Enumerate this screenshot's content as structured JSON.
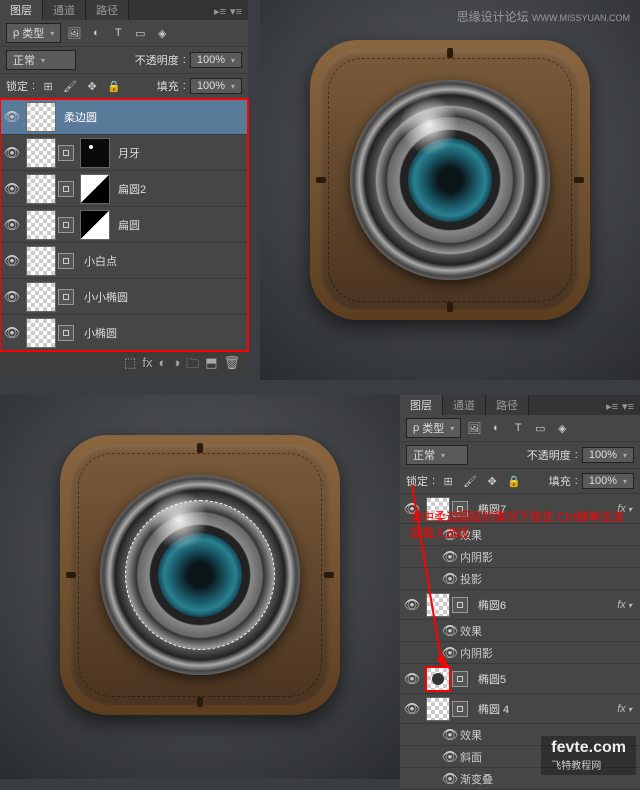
{
  "watermark_main": "思缘设计论坛",
  "watermark_url": "WWW.MISSYUAN.COM",
  "watermark_bottom": "fevte.com",
  "watermark_bottom_cn": "飞特教程网",
  "panel1": {
    "tabs": [
      "图层",
      "通道",
      "路径"
    ],
    "active_tab": 0,
    "kind_label": "类型",
    "blend_mode": "正常",
    "opacity_label": "不透明度",
    "opacity_value": "100%",
    "lock_label": "锁定",
    "fill_label": "填充",
    "fill_value": "100%",
    "layers": [
      {
        "name": "柔边圆",
        "visible": true,
        "selected": true,
        "thumbs": [
          "checker"
        ]
      },
      {
        "name": "月牙",
        "visible": true,
        "selected": false,
        "thumbs": [
          "checker",
          "vec",
          "black"
        ]
      },
      {
        "name": "扁圆2",
        "visible": true,
        "selected": false,
        "thumbs": [
          "checker",
          "vec",
          "diag1"
        ]
      },
      {
        "name": "扁圆",
        "visible": true,
        "selected": false,
        "thumbs": [
          "checker",
          "vec",
          "diag2"
        ]
      },
      {
        "name": "小白点",
        "visible": true,
        "selected": false,
        "thumbs": [
          "checker",
          "vec"
        ]
      },
      {
        "name": "小小椭圆",
        "visible": true,
        "selected": false,
        "thumbs": [
          "checker",
          "vec"
        ]
      },
      {
        "name": "小椭圆",
        "visible": true,
        "selected": false,
        "thumbs": [
          "checker",
          "vec"
        ]
      }
    ]
  },
  "panel2": {
    "tabs": [
      "图层",
      "通道",
      "路径"
    ],
    "active_tab": 0,
    "kind_label": "类型",
    "blend_mode": "正常",
    "opacity_label": "不透明度",
    "opacity_value": "100%",
    "lock_label": "锁定",
    "fill_label": "填充",
    "fill_value": "100%",
    "layers": [
      {
        "name": "椭圆7",
        "fx": true,
        "visible": true,
        "effects": [
          "效果",
          "内阴影",
          "投影"
        ]
      },
      {
        "name": "椭圆6",
        "fx": true,
        "visible": true,
        "effects": [
          "效果",
          "内阴影"
        ]
      },
      {
        "name": "椭圆5",
        "fx": false,
        "visible": true,
        "highlight_thumb": true,
        "effects": []
      },
      {
        "name": "椭圆 4",
        "fx": true,
        "visible": true,
        "effects": [
          "效果",
          "斜面",
          "渐变叠"
        ]
      }
    ]
  },
  "annotation": "选中柔边圆层的情况下按住\nCtrl键单击该层载入选区",
  "icons": {
    "eye": "👁",
    "link": "⬚",
    "fx": "fx",
    "mask": "◻",
    "folder": "🗀",
    "new": "⬒",
    "trash": "🗑",
    "menu": "≡",
    "filter_img": "🖼",
    "filter_adj": "◐",
    "filter_t": "T",
    "filter_shape": "▭",
    "filter_smart": "◈",
    "lock_pix": "🖌",
    "lock_pos": "✥",
    "lock_all": "🔒"
  }
}
